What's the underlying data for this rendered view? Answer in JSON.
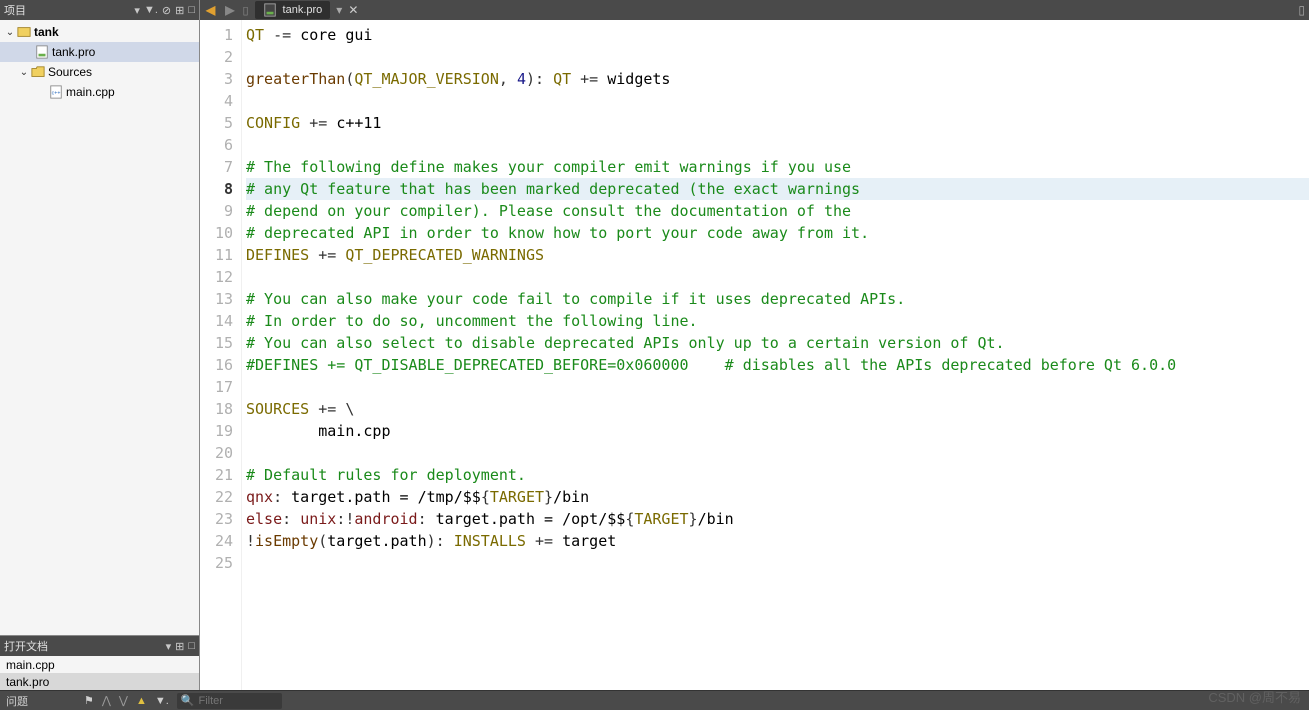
{
  "sidebar": {
    "project_title": "项目",
    "tree": {
      "root": {
        "label": "tank"
      },
      "pro": {
        "label": "tank.pro"
      },
      "sources": {
        "label": "Sources"
      },
      "main": {
        "label": "main.cpp"
      }
    },
    "open_docs_title": "打开文档",
    "docs": [
      {
        "label": "main.cpp"
      },
      {
        "label": "tank.pro"
      }
    ]
  },
  "tab": {
    "filename": "tank.pro"
  },
  "editor": {
    "highlighted_line": 8,
    "lines": [
      {
        "n": 1,
        "type": "code",
        "tokens": [
          [
            "kw",
            "QT"
          ],
          [
            "op",
            " -= "
          ],
          [
            "",
            "core gui"
          ]
        ]
      },
      {
        "n": 2,
        "type": "blank"
      },
      {
        "n": 3,
        "type": "code",
        "tokens": [
          [
            "fn",
            "greaterThan"
          ],
          [
            "op",
            "("
          ],
          [
            "kw",
            "QT_MAJOR_VERSION"
          ],
          [
            "op",
            ", "
          ],
          [
            "num",
            "4"
          ],
          [
            "op",
            ")"
          ],
          [
            "op",
            ": "
          ],
          [
            "kw",
            "QT"
          ],
          [
            "op",
            " += "
          ],
          [
            "",
            "widgets"
          ]
        ]
      },
      {
        "n": 4,
        "type": "blank"
      },
      {
        "n": 5,
        "type": "code",
        "tokens": [
          [
            "kw",
            "CONFIG"
          ],
          [
            "op",
            " += "
          ],
          [
            "",
            "c++11"
          ]
        ]
      },
      {
        "n": 6,
        "type": "blank"
      },
      {
        "n": 7,
        "type": "comment",
        "text": "# The following define makes your compiler emit warnings if you use"
      },
      {
        "n": 8,
        "type": "comment",
        "text": "# any Qt feature that has been marked deprecated (the exact warnings"
      },
      {
        "n": 9,
        "type": "comment",
        "text": "# depend on your compiler). Please consult the documentation of the"
      },
      {
        "n": 10,
        "type": "comment",
        "text": "# deprecated API in order to know how to port your code away from it."
      },
      {
        "n": 11,
        "type": "code",
        "tokens": [
          [
            "kw",
            "DEFINES"
          ],
          [
            "op",
            " += "
          ],
          [
            "kw",
            "QT_DEPRECATED_WARNINGS"
          ]
        ]
      },
      {
        "n": 12,
        "type": "blank"
      },
      {
        "n": 13,
        "type": "comment",
        "text": "# You can also make your code fail to compile if it uses deprecated APIs."
      },
      {
        "n": 14,
        "type": "comment",
        "text": "# In order to do so, uncomment the following line."
      },
      {
        "n": 15,
        "type": "comment",
        "text": "# You can also select to disable deprecated APIs only up to a certain version of Qt."
      },
      {
        "n": 16,
        "type": "comment",
        "text": "#DEFINES += QT_DISABLE_DEPRECATED_BEFORE=0x060000    # disables all the APIs deprecated before Qt 6.0.0"
      },
      {
        "n": 17,
        "type": "blank"
      },
      {
        "n": 18,
        "type": "code",
        "tokens": [
          [
            "kw",
            "SOURCES"
          ],
          [
            "op",
            " += \\\\"
          ]
        ]
      },
      {
        "n": 19,
        "type": "code",
        "tokens": [
          [
            "",
            "        main.cpp"
          ]
        ]
      },
      {
        "n": 20,
        "type": "blank"
      },
      {
        "n": 21,
        "type": "comment",
        "text": "# Default rules for deployment."
      },
      {
        "n": 22,
        "type": "code",
        "tokens": [
          [
            "var",
            "qnx"
          ],
          [
            "op",
            ": "
          ],
          [
            "",
            "target.path = /tmp/$$"
          ],
          [
            "op",
            "{"
          ],
          [
            "kw",
            "TARGET"
          ],
          [
            "op",
            "}"
          ],
          [
            "",
            "/bin"
          ]
        ]
      },
      {
        "n": 23,
        "type": "code",
        "tokens": [
          [
            "var",
            "else"
          ],
          [
            "op",
            ": "
          ],
          [
            "var",
            "unix"
          ],
          [
            "op",
            ":!"
          ],
          [
            "var",
            "android"
          ],
          [
            "op",
            ": "
          ],
          [
            "",
            "target.path = /opt/$$"
          ],
          [
            "op",
            "{"
          ],
          [
            "kw",
            "TARGET"
          ],
          [
            "op",
            "}"
          ],
          [
            "",
            "/bin"
          ]
        ]
      },
      {
        "n": 24,
        "type": "code",
        "tokens": [
          [
            "op",
            "!"
          ],
          [
            "fn",
            "isEmpty"
          ],
          [
            "op",
            "("
          ],
          [
            "",
            "target.path"
          ],
          [
            "op",
            ")"
          ],
          [
            "op",
            ": "
          ],
          [
            "kw",
            "INSTALLS"
          ],
          [
            "op",
            " += "
          ],
          [
            "",
            "target"
          ]
        ]
      },
      {
        "n": 25,
        "type": "blank"
      }
    ]
  },
  "bottom": {
    "issues_label": "问题",
    "filter_placeholder": "Filter"
  },
  "watermark": "CSDN @周不易"
}
